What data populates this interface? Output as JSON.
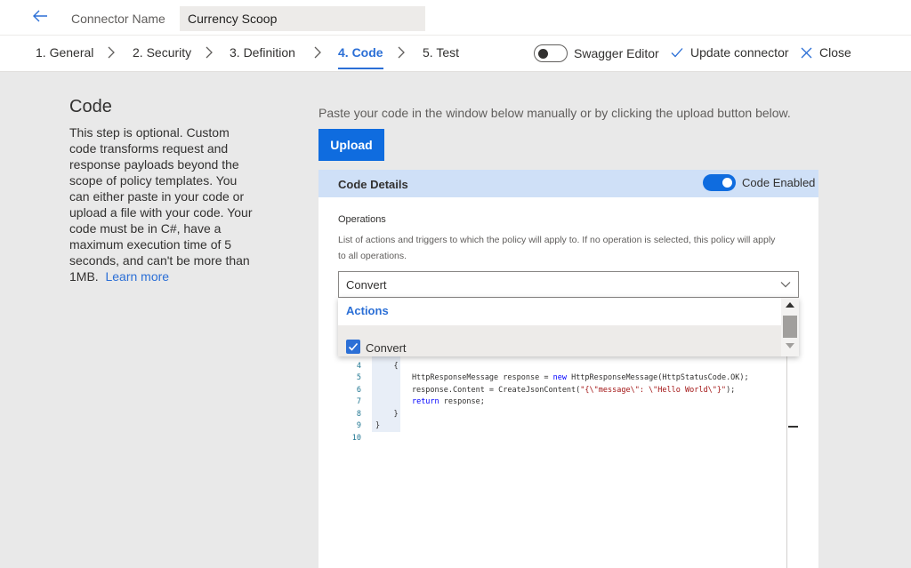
{
  "header": {
    "connector_label": "Connector Name",
    "connector_value": "Currency Scoop"
  },
  "nav": {
    "steps": [
      "1. General",
      "2. Security",
      "3. Definition",
      "4. Code",
      "5. Test"
    ],
    "active_step": "4. Code",
    "swagger_label": "Swagger Editor",
    "swagger_enabled": false,
    "update_label": "Update connector",
    "close_label": "Close"
  },
  "left": {
    "title": "Code",
    "description": "This step is optional. Custom code transforms request and response payloads beyond the scope of policy templates. You can either paste in your code or upload a file with your code. Your code must be in C#, have a maximum execution time of 5 seconds, and can't be more than 1MB.",
    "learn_more": "Learn more"
  },
  "main": {
    "instruction": "Paste your code in the window below manually or by clicking the upload button below.",
    "upload_label": "Upload",
    "panel": {
      "title": "Code Details",
      "code_enabled_label": "Code Enabled",
      "code_enabled": true,
      "operations_label": "Operations",
      "operations_desc": "List of actions and triggers to which the policy will apply to. If no operation is selected, this policy will apply to all operations.",
      "selected_operation": "Convert",
      "dropdown_header": "Actions",
      "dropdown_option": "Convert",
      "option_checked": true
    }
  },
  "colors": {
    "accent": "#2b6fd6",
    "primary_button": "#0f6cdf",
    "panel_header": "#cfe0f7"
  },
  "editor": {
    "line_numbers": [
      "4",
      "5",
      "6",
      "7",
      "8",
      "9",
      "10"
    ],
    "lines": [
      "    {",
      "        HttpResponseMessage response = new HttpResponseMessage(HttpStatusCode.OK);",
      "        response.Content = CreateJsonContent(\"{\\\"message\\\": \\\"Hello World\\\"}\");",
      "        return response;",
      "    }",
      "}",
      ""
    ]
  }
}
